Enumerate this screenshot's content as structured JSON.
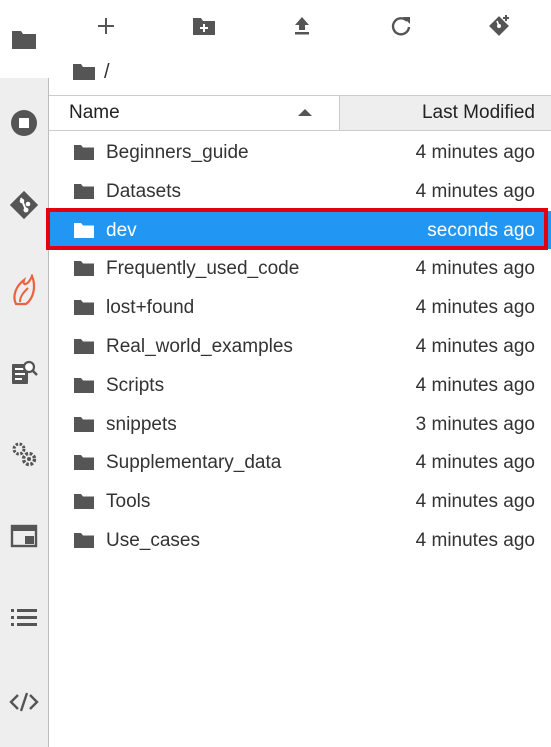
{
  "toolbar": {
    "buttons": [
      {
        "name": "new-launcher",
        "icon": "plus-icon"
      },
      {
        "name": "new-folder",
        "icon": "new-folder-icon"
      },
      {
        "name": "upload",
        "icon": "upload-icon"
      },
      {
        "name": "refresh",
        "icon": "refresh-icon"
      },
      {
        "name": "git-clone",
        "icon": "git-clone-icon"
      }
    ]
  },
  "breadcrumb": {
    "path": "/"
  },
  "header": {
    "name_label": "Name",
    "modified_label": "Last Modified",
    "sort": "ascending"
  },
  "files": [
    {
      "name": "Beginners_guide",
      "modified": "4 minutes ago",
      "selected": false
    },
    {
      "name": "Datasets",
      "modified": "4 minutes ago",
      "selected": false
    },
    {
      "name": "dev",
      "modified": "seconds ago",
      "selected": true
    },
    {
      "name": "Frequently_used_code",
      "modified": "4 minutes ago",
      "selected": false
    },
    {
      "name": "lost+found",
      "modified": "4 minutes ago",
      "selected": false
    },
    {
      "name": "Real_world_examples",
      "modified": "4 minutes ago",
      "selected": false
    },
    {
      "name": "Scripts",
      "modified": "4 minutes ago",
      "selected": false
    },
    {
      "name": "snippets",
      "modified": "3 minutes ago",
      "selected": false
    },
    {
      "name": "Supplementary_data",
      "modified": "4 minutes ago",
      "selected": false
    },
    {
      "name": "Tools",
      "modified": "4 minutes ago",
      "selected": false
    },
    {
      "name": "Use_cases",
      "modified": "4 minutes ago",
      "selected": false
    }
  ],
  "sidebar": {
    "items": [
      {
        "name": "file-browser",
        "icon": "folder-icon",
        "active": true
      },
      {
        "name": "running-sessions",
        "icon": "stop-circle-icon"
      },
      {
        "name": "git",
        "icon": "git-icon"
      },
      {
        "name": "extension",
        "icon": "flame-icon"
      },
      {
        "name": "property-inspector",
        "icon": "inspector-icon"
      },
      {
        "name": "settings",
        "icon": "gears-icon"
      },
      {
        "name": "tabs",
        "icon": "window-icon"
      },
      {
        "name": "table-of-contents",
        "icon": "list-icon"
      },
      {
        "name": "code-snippets",
        "icon": "code-icon"
      }
    ]
  },
  "colors": {
    "selection": "#2196f3",
    "highlight_border": "#e3000f",
    "flame_accent": "#e8643c"
  }
}
